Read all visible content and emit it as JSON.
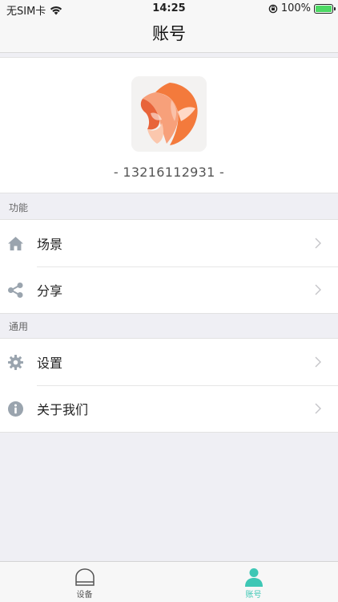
{
  "status_bar": {
    "carrier": "无SIM卡",
    "time": "14:25",
    "battery": "100%"
  },
  "nav": {
    "title": "账号"
  },
  "profile": {
    "phone": "- 13216112931 -"
  },
  "sections": {
    "features": {
      "header": "功能",
      "items": [
        {
          "label": "场景",
          "icon": "home-icon"
        },
        {
          "label": "分享",
          "icon": "share-icon"
        }
      ]
    },
    "general": {
      "header": "通用",
      "items": [
        {
          "label": "设置",
          "icon": "gear-icon"
        },
        {
          "label": "关于我们",
          "icon": "info-icon"
        }
      ]
    }
  },
  "tab_bar": {
    "tabs": [
      {
        "label": "设备",
        "icon": "device-icon",
        "active": false
      },
      {
        "label": "账号",
        "icon": "person-icon",
        "active": true
      }
    ],
    "active_color": "#3ec7b5",
    "inactive_color": "#555555"
  }
}
